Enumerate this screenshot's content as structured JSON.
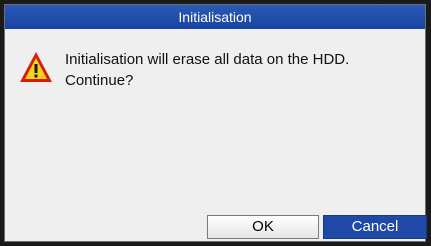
{
  "dialog": {
    "title": "Initialisation",
    "message_line1": "Initialisation will erase all data on the HDD.",
    "message_line2": "Continue?",
    "icon": "warning-icon",
    "buttons": {
      "ok_label": "OK",
      "cancel_label": "Cancel"
    }
  },
  "colors": {
    "titlebar": "#2150b0",
    "dialog_background": "#efefef",
    "cancel_button": "#1f49a6",
    "warning_red": "#d21d10",
    "warning_yellow": "#f5d21e"
  }
}
